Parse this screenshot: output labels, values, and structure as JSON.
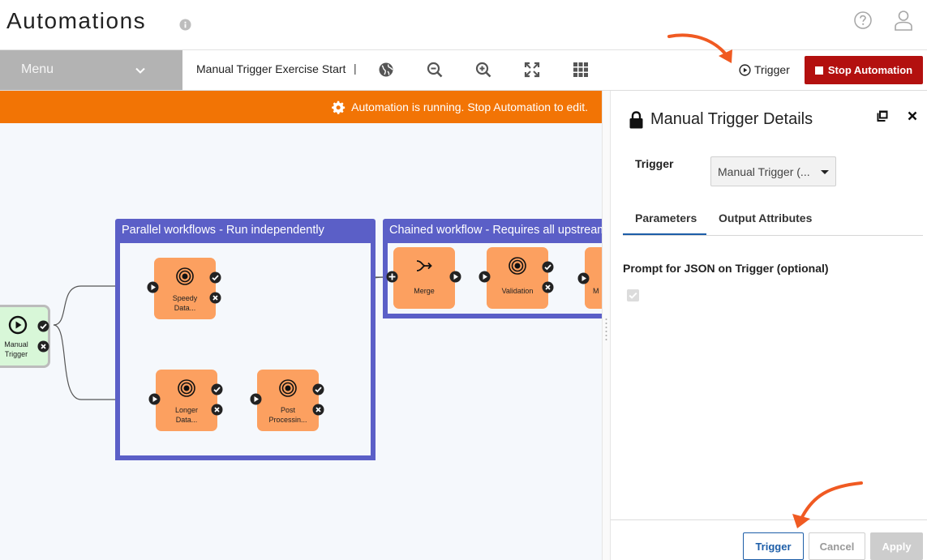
{
  "header": {
    "title": "Automations"
  },
  "toolbar": {
    "menu_label": "Menu",
    "automation_name": "Manual Trigger Exercise Start",
    "separator": "|",
    "trigger_label": "Trigger",
    "stop_label": "Stop Automation",
    "icons": [
      "globe-icon",
      "zoom-out-icon",
      "zoom-in-icon",
      "fit-screen-icon",
      "grid-icon"
    ]
  },
  "banner": {
    "text": "Automation is running. Stop Automation to edit."
  },
  "canvas": {
    "groups": [
      {
        "title": "Parallel workflows - Run independently"
      },
      {
        "title": "Chained workflow - Requires all upstream"
      }
    ],
    "trigger_node": {
      "label_line1": "Manual",
      "label_line2": "Trigger"
    },
    "nodes": [
      {
        "label_line1": "Speedy",
        "label_line2": "Data..."
      },
      {
        "label_line1": "Longer",
        "label_line2": "Data..."
      },
      {
        "label_line1": "Post",
        "label_line2": "Processin..."
      },
      {
        "label_line1": "Merge"
      },
      {
        "label_line1": "Validation"
      },
      {
        "label_line1": "M"
      }
    ]
  },
  "panel": {
    "title": "Manual Trigger Details",
    "trigger_field_label": "Trigger",
    "trigger_select_value": "Manual Trigger (...",
    "tabs": [
      "Parameters",
      "Output Attributes"
    ],
    "prompt_label": "Prompt for JSON on Trigger (optional)",
    "prompt_checked": true,
    "buttons": {
      "trigger": "Trigger",
      "cancel": "Cancel",
      "apply": "Apply"
    }
  },
  "colors": {
    "accent_blue": "#1d5ea8",
    "group_purple": "#5b5fc7",
    "node_orange": "#fca060",
    "banner_orange": "#f27405",
    "stop_red": "#b3100f",
    "annotation_arrow": "#f05a22"
  }
}
